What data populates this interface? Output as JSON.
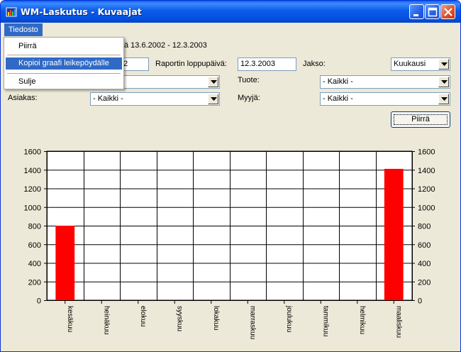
{
  "window": {
    "title": "WM-Laskutus - Kuvaajat"
  },
  "menubar": {
    "tiedosto": "Tiedosto"
  },
  "menu": {
    "items": [
      "Piirrä",
      "Kopioi graafi leikepöydälle",
      "Sulje"
    ],
    "highlighted_index": 1
  },
  "form": {
    "data_range_text": "ä 13.6.2002 - 12.3.2003",
    "start_date_partial": "2",
    "end_date_label": "Raportin loppupäivä:",
    "end_date_value": "12.3.2003",
    "period_label": "Jakso:",
    "period_value": "Kuukausi",
    "product_label": "Tuote:",
    "product_value": "- Kaikki -",
    "customer_label": "Asiakas:",
    "customer_value": "- Kaikki -",
    "seller_label": "Myyjä:",
    "seller_value": "- Kaikki -",
    "draw_button": "Piirrä"
  },
  "colors": {
    "titlebar": "#0b5ce6",
    "bar": "#ff0000",
    "menu_highlight": "#316ac5"
  },
  "chart_data": {
    "type": "bar",
    "categories": [
      "kesäkuu",
      "heinäkuu",
      "elokuu",
      "syyskuu",
      "lokakuu",
      "marraskuu",
      "joulukuu",
      "tammikuu",
      "helmikuu",
      "maaliskuu"
    ],
    "values": [
      800,
      0,
      0,
      0,
      0,
      0,
      0,
      0,
      0,
      1410
    ],
    "ylim": [
      0,
      1600
    ],
    "yticks": [
      0,
      200,
      400,
      600,
      800,
      1000,
      1200,
      1400,
      1600
    ],
    "grid": true,
    "title": "",
    "xlabel": "",
    "ylabel": ""
  }
}
